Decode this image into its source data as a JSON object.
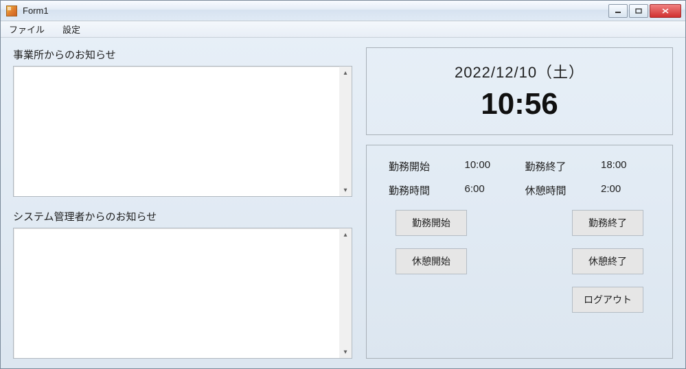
{
  "window": {
    "title": "Form1"
  },
  "menu": {
    "file": "ファイル",
    "settings": "設定"
  },
  "left": {
    "office_notice_label": "事業所からのお知らせ",
    "office_notice_text": "",
    "admin_notice_label": "システム管理者からのお知らせ",
    "admin_notice_text": ""
  },
  "clock": {
    "date": "2022/12/10（土）",
    "time": "10:56"
  },
  "work": {
    "start_label": "勤務開始",
    "start_value": "10:00",
    "end_label": "勤務終了",
    "end_value": "18:00",
    "hours_label": "勤務時間",
    "hours_value": "6:00",
    "break_label": "休憩時間",
    "break_value": "2:00",
    "btn_start_work": "勤務開始",
    "btn_end_work": "勤務終了",
    "btn_start_break": "休憩開始",
    "btn_end_break": "休憩終了",
    "btn_logout": "ログアウト"
  }
}
